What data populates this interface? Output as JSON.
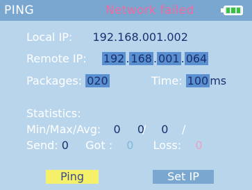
{
  "header": {
    "mode": "PING",
    "status": "Network failed",
    "battery_icon": "battery-full-icon"
  },
  "config": {
    "local_ip_label": "Local IP:",
    "local_ip_value": "192.168.001.002",
    "remote_ip_label": "Remote IP:",
    "remote_ip_octets": [
      "192",
      "168",
      "001",
      "064"
    ],
    "packages_label": "Packages:",
    "packages_value": "020",
    "time_label": "Time:",
    "time_value": "100",
    "time_unit": "ms"
  },
  "statistics": {
    "title": "Statistics:",
    "minmaxavg_label": "Min/Max/Avg:",
    "min": "0",
    "max": "0",
    "avg": "0",
    "send_label": "Send:",
    "send_value": "0",
    "got_label": "Got :",
    "got_value": "0",
    "loss_label": "Loss:",
    "loss_value": "0"
  },
  "buttons": {
    "ping": "Ping",
    "set_ip": "Set IP"
  },
  "colors": {
    "background": "#b9d5ec",
    "header": "#7aa7cf",
    "status_error": "#f06aa0",
    "ping_button": "#f5f06a",
    "highlight": "#5a8fd0"
  }
}
